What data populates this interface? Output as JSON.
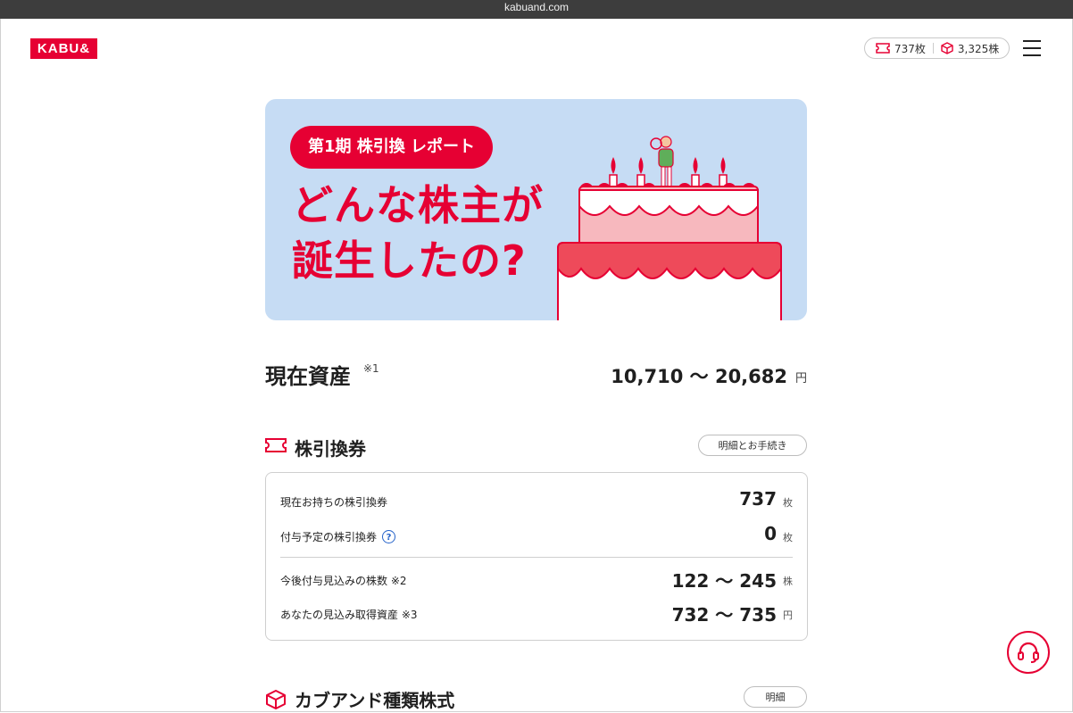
{
  "browser": {
    "url": "kabuand.com"
  },
  "header": {
    "logo": "KABU&",
    "tickets": "737枚",
    "shares": "3,325株"
  },
  "banner": {
    "label": "第1期 株引換 レポート",
    "title_line1": "どんな株主が",
    "title_line2": "誕生したの?"
  },
  "assets": {
    "title": "現在資産",
    "note": "※1",
    "value": "10,710 〜 20,682",
    "unit": "円"
  },
  "tickets_section": {
    "title": "株引換券",
    "button": "明細とお手続き",
    "rows": [
      {
        "label": "現在お持ちの株引換券",
        "value": "737",
        "unit": "枚"
      },
      {
        "label": "付与予定の株引換券",
        "value": "0",
        "unit": "枚"
      },
      {
        "label": "今後付与見込みの株数 ※2",
        "value": "122 〜 245",
        "unit": "株"
      },
      {
        "label": "あなたの見込み取得資産 ※3",
        "value": "732 〜 735",
        "unit": "円"
      }
    ],
    "help_symbol": "?"
  },
  "shares_section": {
    "title": "カブアンド種類株式",
    "button": "明細"
  },
  "colors": {
    "brand": "#e60033",
    "banner_bg": "#c6dcf4",
    "help": "#2563c9"
  },
  "icons": [
    "ticket-icon",
    "cube-icon",
    "menu-icon",
    "question-icon",
    "headset-icon"
  ]
}
